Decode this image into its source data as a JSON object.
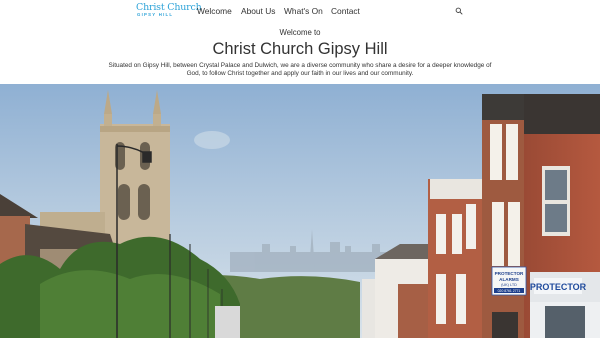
{
  "brand": {
    "name_line1": "Christ Church",
    "name_line2": "GIPSY HILL",
    "color": "#2ea3d8"
  },
  "nav": {
    "items": [
      {
        "label": "Welcome"
      },
      {
        "label": "About Us"
      },
      {
        "label": "What's On"
      },
      {
        "label": "Contact"
      }
    ],
    "search_icon": "search-icon"
  },
  "intro": {
    "welcome": "Welcome to",
    "title": "Christ Church Gipsy Hill",
    "description": "Situated on Gipsy Hill, between Crystal Palace and Dulwich, we are a diverse community who share a desire for a deeper knowledge of God, to follow Christ together and apply our faith in our lives and our community."
  },
  "hero": {
    "signs": {
      "alarm_line1": "PROTECTOR",
      "alarm_line2": "ALARMS",
      "alarm_line3": "(UK) LTD",
      "alarm_phone": "020 8761 2771",
      "shop": "PROTECTOR"
    }
  }
}
